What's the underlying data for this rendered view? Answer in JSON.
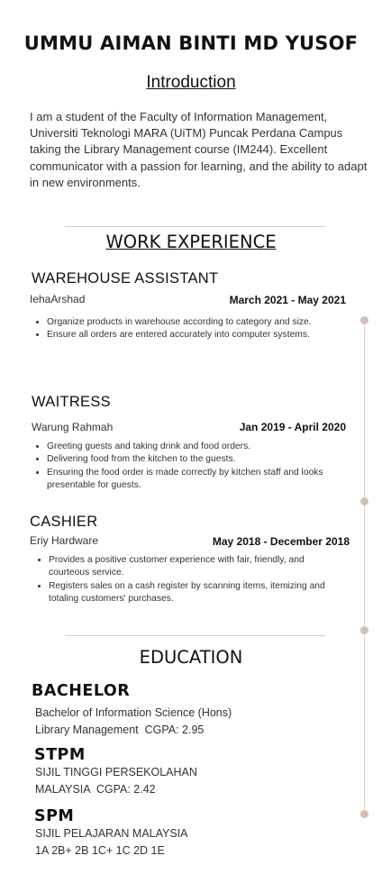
{
  "name": "UMMU AIMAN BINTI MD YUSOF",
  "introduction": {
    "title": "Introduction",
    "text": "I am a student of the Faculty of Information Management, Universiti Teknologi MARA (UiTM) Puncak Perdana Campus taking the Library Management course (IM244). Excellent communicator with a passion for learning, and the ability to adapt in new environments."
  },
  "work": {
    "title": "WORK EXPERIENCE",
    "jobs": [
      {
        "title": "WAREHOUSE ASSISTANT",
        "company": "IehaArshad",
        "dates": "March 2021 - May 2021",
        "bullets": [
          "Organize products in warehouse according to category and size.",
          "Ensure all orders are entered accurately into computer systems."
        ]
      },
      {
        "title": "WAITRESS",
        "company": "Warung Rahmah",
        "dates": "Jan 2019 - April 2020",
        "bullets": [
          "Greeting guests and taking drink and food orders.",
          "Delivering food from the kitchen to the guests.",
          "Ensuring the food order is made correctly by kitchen staff and looks presentable for guests."
        ]
      },
      {
        "title": "CASHIER",
        "company": "Eriy Hardware",
        "dates": "May 2018 - December 2018",
        "bullets": [
          "Provides a positive customer experience with fair, friendly, and courteous service.",
          "Registers sales on a cash register by scanning items, itemizing and totaling customers' purchases."
        ]
      }
    ]
  },
  "education": {
    "title": "EDUCATION",
    "items": [
      {
        "title": "BACHELOR",
        "line1": "Bachelor of Information Science (Hons)",
        "line2": "Library Management  CGPA: 2.95"
      },
      {
        "title": "STPM",
        "line1": "SIJIL TINGGI PERSEKOLAHAN",
        "line2": "MALAYSIA  CGPA: 2.42"
      },
      {
        "title": "SPM",
        "line1": "SIJIL PELAJARAN MALAYSIA",
        "line2": "1A 2B+ 2B 1C+ 1C 2D 1E"
      }
    ]
  },
  "colors": {
    "accent_dot": "#d2c0b6",
    "divider": "#d9cfc8"
  }
}
